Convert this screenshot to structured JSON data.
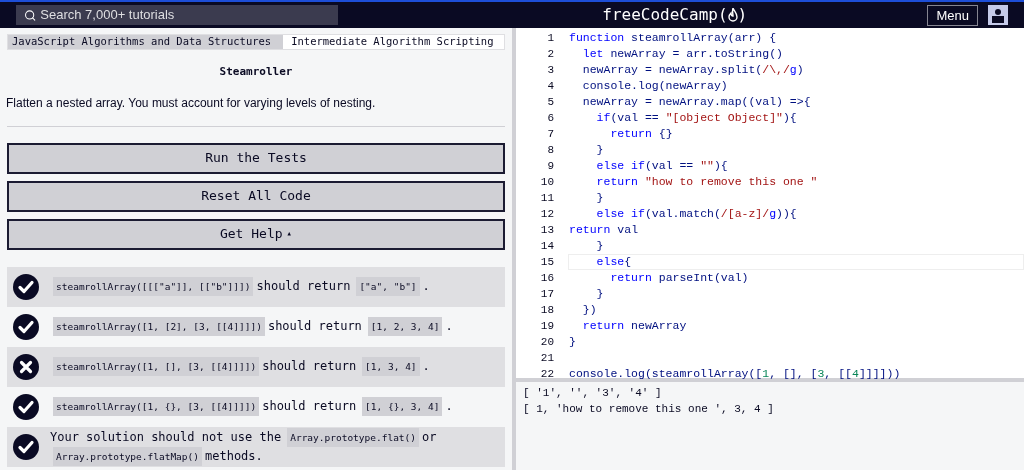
{
  "header": {
    "search_placeholder": "Search 7,000+ tutorials",
    "logo": {
      "text": "freeCodeCamp",
      "open": "(",
      "close": ")"
    },
    "menu": "Menu"
  },
  "breadcrumbs": [
    {
      "label": "JavaScript Algorithms and Data Structures"
    },
    {
      "label": "Intermediate Algorithm Scripting"
    }
  ],
  "challenge": {
    "title": "Steamroller",
    "description": "Flatten a nested array. You must account for varying levels of nesting."
  },
  "buttons": [
    {
      "label": "Run the Tests"
    },
    {
      "label": "Reset All Code"
    },
    {
      "label": "Get Help",
      "caret": "▴"
    }
  ],
  "tests": [
    {
      "passed": true,
      "parts": [
        {
          "kind": "code",
          "text": "steamrollArray([[[\"a\"]], [[\"b\"]]])"
        },
        {
          "kind": "text",
          "text": "should return"
        },
        {
          "kind": "code",
          "text": "[\"a\", \"b\"]"
        },
        {
          "kind": "text",
          "text": "."
        }
      ]
    },
    {
      "passed": true,
      "parts": [
        {
          "kind": "code",
          "text": "steamrollArray([1, [2], [3, [[4]]]])"
        },
        {
          "kind": "text",
          "text": "should return"
        },
        {
          "kind": "code",
          "text": "[1, 2, 3, 4]"
        },
        {
          "kind": "text",
          "text": "."
        }
      ]
    },
    {
      "passed": false,
      "parts": [
        {
          "kind": "code",
          "text": "steamrollArray([1, [], [3, [[4]]]])"
        },
        {
          "kind": "text",
          "text": "should return"
        },
        {
          "kind": "code",
          "text": "[1, 3, 4]"
        },
        {
          "kind": "text",
          "text": "."
        }
      ]
    },
    {
      "passed": true,
      "parts": [
        {
          "kind": "code",
          "text": "steamrollArray([1, {}, [3, [[4]]]])"
        },
        {
          "kind": "text",
          "text": "should return"
        },
        {
          "kind": "code",
          "text": "[1, {}, 3, 4]"
        },
        {
          "kind": "text",
          "text": "."
        }
      ]
    },
    {
      "passed": true,
      "parts": [
        {
          "kind": "text",
          "text": "Your solution should not use the"
        },
        {
          "kind": "code",
          "text": "Array.prototype.flat()"
        },
        {
          "kind": "text",
          "text": "or"
        },
        {
          "kind": "code",
          "text": "Array.prototype.flatMap()"
        },
        {
          "kind": "text",
          "text": "methods."
        }
      ]
    }
  ],
  "editor": {
    "lines": [
      {
        "number": "1",
        "active": false,
        "tokens": [
          {
            "kind": "kw",
            "text": "function"
          },
          {
            "kind": "plain",
            "text": " steamrollArray(arr) {"
          }
        ]
      },
      {
        "number": "2",
        "active": false,
        "tokens": [
          {
            "kind": "kw",
            "text": "  let"
          },
          {
            "kind": "plain",
            "text": " newArray = arr.toString()"
          }
        ]
      },
      {
        "number": "3",
        "active": false,
        "tokens": [
          {
            "kind": "plain",
            "text": "  newArray = newArray.split("
          },
          {
            "kind": "str",
            "text": "/\\,/"
          },
          {
            "kind": "kw",
            "text": "g"
          },
          {
            "kind": "plain",
            "text": ")"
          }
        ]
      },
      {
        "number": "4",
        "active": false,
        "tokens": [
          {
            "kind": "plain",
            "text": "  console.log(newArray)"
          }
        ]
      },
      {
        "number": "5",
        "active": false,
        "tokens": [
          {
            "kind": "plain",
            "text": "  newArray = newArray.map((val) =>{"
          }
        ]
      },
      {
        "number": "6",
        "active": false,
        "tokens": [
          {
            "kind": "kw",
            "text": "    if"
          },
          {
            "kind": "plain",
            "text": "(val == "
          },
          {
            "kind": "str",
            "text": "\"[object Object]\""
          },
          {
            "kind": "plain",
            "text": "){"
          }
        ]
      },
      {
        "number": "7",
        "active": false,
        "tokens": [
          {
            "kind": "kw",
            "text": "      return"
          },
          {
            "kind": "plain",
            "text": " {}"
          }
        ]
      },
      {
        "number": "8",
        "active": false,
        "tokens": [
          {
            "kind": "plain",
            "text": "    }"
          }
        ]
      },
      {
        "number": "9",
        "active": false,
        "tokens": [
          {
            "kind": "kw",
            "text": "    else if"
          },
          {
            "kind": "plain",
            "text": "(val == "
          },
          {
            "kind": "str",
            "text": "\"\""
          },
          {
            "kind": "plain",
            "text": "){"
          }
        ]
      },
      {
        "number": "10",
        "active": false,
        "tokens": [
          {
            "kind": "kw",
            "text": "    return"
          },
          {
            "kind": "str",
            "text": " \"how to remove this one \""
          }
        ]
      },
      {
        "number": "11",
        "active": false,
        "tokens": [
          {
            "kind": "plain",
            "text": "    }"
          }
        ]
      },
      {
        "number": "12",
        "active": false,
        "tokens": [
          {
            "kind": "kw",
            "text": "    else if"
          },
          {
            "kind": "plain",
            "text": "(val.match("
          },
          {
            "kind": "str",
            "text": "/[a-z]/"
          },
          {
            "kind": "kw",
            "text": "g"
          },
          {
            "kind": "plain",
            "text": ")){"
          }
        ]
      },
      {
        "number": "13",
        "active": false,
        "tokens": [
          {
            "kind": "kw",
            "text": "return"
          },
          {
            "kind": "plain",
            "text": " val"
          }
        ]
      },
      {
        "number": "14",
        "active": false,
        "tokens": [
          {
            "kind": "plain",
            "text": "    }"
          }
        ]
      },
      {
        "number": "15",
        "active": true,
        "tokens": [
          {
            "kind": "kw",
            "text": "    else"
          },
          {
            "kind": "plain",
            "text": "{"
          }
        ]
      },
      {
        "number": "16",
        "active": false,
        "tokens": [
          {
            "kind": "kw",
            "text": "      return"
          },
          {
            "kind": "plain",
            "text": " parseInt(val)"
          }
        ]
      },
      {
        "number": "17",
        "active": false,
        "tokens": [
          {
            "kind": "plain",
            "text": "    }"
          }
        ]
      },
      {
        "number": "18",
        "active": false,
        "tokens": [
          {
            "kind": "plain",
            "text": "  })"
          }
        ]
      },
      {
        "number": "19",
        "active": false,
        "tokens": [
          {
            "kind": "kw",
            "text": "  return"
          },
          {
            "kind": "plain",
            "text": " newArray"
          }
        ]
      },
      {
        "number": "20",
        "active": false,
        "tokens": [
          {
            "kind": "plain",
            "text": "}"
          }
        ]
      },
      {
        "number": "21"
      },
      {
        "number": "22",
        "active": false,
        "tokens": [
          {
            "kind": "plain",
            "text": "console.log(steamrollArray(["
          },
          {
            "kind": "num",
            "text": "1"
          },
          {
            "kind": "plain",
            "text": ", [], ["
          },
          {
            "kind": "num",
            "text": "3"
          },
          {
            "kind": "plain",
            "text": ", [["
          },
          {
            "kind": "num",
            "text": "4"
          },
          {
            "kind": "plain",
            "text": "]]]]))"
          }
        ]
      }
    ]
  },
  "console": {
    "lines": [
      "[ '1', '', '3', '4' ]",
      "[ 1, 'how to remove this one ', 3, 4 ]"
    ]
  }
}
